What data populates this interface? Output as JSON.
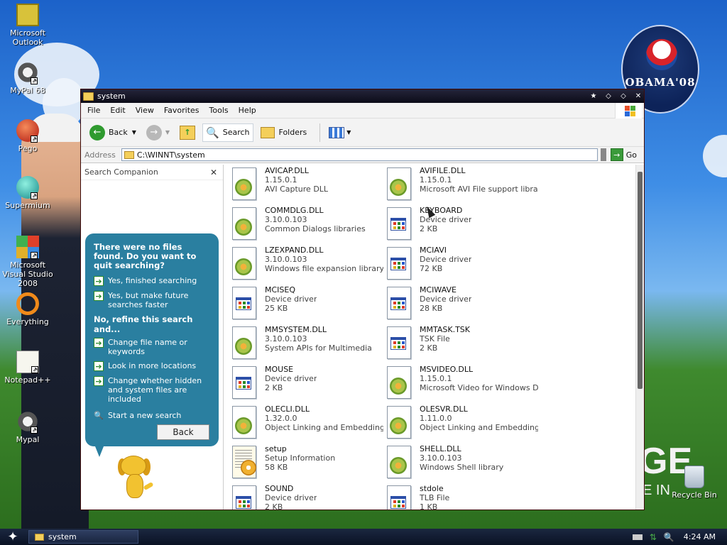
{
  "desktop": {
    "icons": [
      {
        "label": "Microsoft Outlook",
        "icon": "outlook-icon"
      },
      {
        "label": "MyPal 68",
        "icon": "raccoon-icon"
      },
      {
        "label": "Pego",
        "icon": "pego-icon"
      },
      {
        "label": "Supermium",
        "icon": "supermium-icon"
      },
      {
        "label": "Microsoft Visual Studio 2008",
        "icon": "visual-studio-icon"
      },
      {
        "label": "Everything",
        "icon": "everything-icon"
      },
      {
        "label": "Notepad++",
        "icon": "notepadpp-icon"
      },
      {
        "label": "Mypal",
        "icon": "raccoon-icon"
      }
    ],
    "recycle_bin": "Recycle Bin",
    "badge_text": "OBAMA'08",
    "billboard_text": "GE",
    "billboard_sub": "E IN"
  },
  "window": {
    "title": "system",
    "title_buttons": [
      "★",
      "◇",
      "◇",
      "✕"
    ]
  },
  "menu": [
    "File",
    "Edit",
    "View",
    "Favorites",
    "Tools",
    "Help"
  ],
  "toolbar": {
    "back": "Back",
    "search": "Search",
    "folders": "Folders"
  },
  "address": {
    "label": "Address",
    "value": "C:\\WINNT\\system",
    "go": "Go"
  },
  "search_pane": {
    "title": "Search Companion",
    "close": "✕",
    "heading": "There were no files found. Do you want to quit searching?",
    "options1": [
      "Yes, finished searching",
      "Yes, but make future searches faster"
    ],
    "heading2": "No, refine this search and...",
    "options2": [
      "Change file name or keywords",
      "Look in more locations",
      "Change whether hidden and system files are included"
    ],
    "new_search": "Start a new search",
    "back": "Back"
  },
  "files": [
    {
      "name": "AVICAP.DLL",
      "line2": "1.15.0.1",
      "line3": "AVI Capture DLL",
      "type": "dll"
    },
    {
      "name": "AVIFILE.DLL",
      "line2": "1.15.0.1",
      "line3": "Microsoft AVI File support library",
      "type": "dll"
    },
    {
      "name": "COMMDLG.DLL",
      "line2": "3.10.0.103",
      "line3": "Common Dialogs libraries",
      "type": "dll"
    },
    {
      "name": "KEYBOARD",
      "line2": "Device driver",
      "line3": "2 KB",
      "type": "drv"
    },
    {
      "name": "LZEXPAND.DLL",
      "line2": "3.10.0.103",
      "line3": "Windows file expansion library",
      "type": "dll"
    },
    {
      "name": "MCIAVI",
      "line2": "Device driver",
      "line3": "72 KB",
      "type": "drv"
    },
    {
      "name": "MCISEQ",
      "line2": "Device driver",
      "line3": "25 KB",
      "type": "drv"
    },
    {
      "name": "MCIWAVE",
      "line2": "Device driver",
      "line3": "28 KB",
      "type": "drv"
    },
    {
      "name": "MMSYSTEM.DLL",
      "line2": "3.10.0.103",
      "line3": "System APIs for Multimedia",
      "type": "dll"
    },
    {
      "name": "MMTASK.TSK",
      "line2": "TSK File",
      "line3": "2 KB",
      "type": "drv"
    },
    {
      "name": "MOUSE",
      "line2": "Device driver",
      "line3": "2 KB",
      "type": "drv"
    },
    {
      "name": "MSVIDEO.DLL",
      "line2": "1.15.0.1",
      "line3": "Microsoft Video for Windows DLL",
      "type": "dll"
    },
    {
      "name": "OLECLI.DLL",
      "line2": "1.32.0.0",
      "line3": "Object Linking and Embedding ...",
      "type": "dll"
    },
    {
      "name": "OLESVR.DLL",
      "line2": "1.11.0.0",
      "line3": "Object Linking and Embedding ...",
      "type": "dll"
    },
    {
      "name": "setup",
      "line2": "Setup Information",
      "line3": "58 KB",
      "type": "inf"
    },
    {
      "name": "SHELL.DLL",
      "line2": "3.10.0.103",
      "line3": "Windows Shell library",
      "type": "dll"
    },
    {
      "name": "SOUND",
      "line2": "Device driver",
      "line3": "2 KB",
      "type": "drv"
    },
    {
      "name": "stdole",
      "line2": "TLB File",
      "line3": "1 KB",
      "type": "drv"
    }
  ],
  "taskbar": {
    "task": "system",
    "clock": "4:24 AM"
  },
  "colors": {
    "pane_bubble": "#2a7fa0",
    "go_green": "#3a9a3a",
    "title_dark": "#0c0c18"
  }
}
